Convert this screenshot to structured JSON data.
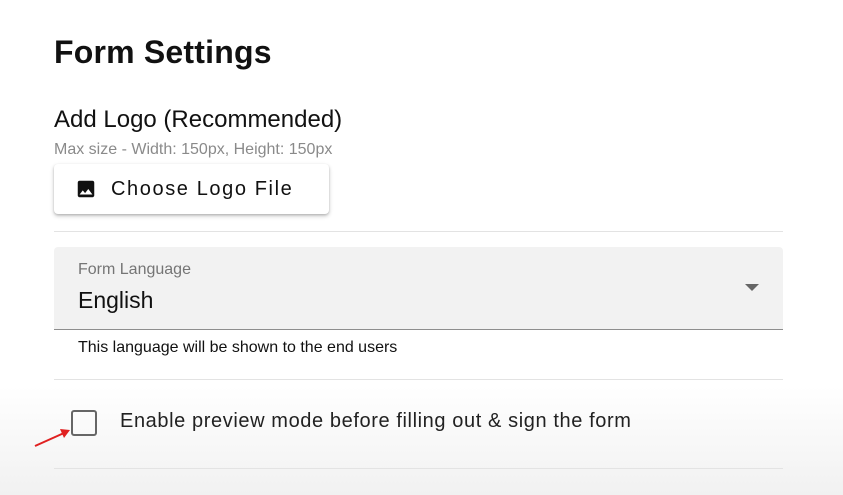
{
  "page": {
    "title": "Form Settings"
  },
  "logo": {
    "heading": "Add Logo (Recommended)",
    "hint": "Max size - Width: 150px, Height: 150px",
    "button_label": "Choose Logo File",
    "button_icon": "image-icon"
  },
  "language": {
    "label": "Form Language",
    "value": "English",
    "helper": "This language will be shown to the end users",
    "dropdown_icon": "caret-down-icon"
  },
  "preview_mode": {
    "label": "Enable preview mode before filling out & sign the form",
    "checked": false
  },
  "annotation": {
    "arrow_color": "#e02020"
  },
  "colors": {
    "field_background": "#f2f2f2",
    "divider": "#e3e3e3",
    "hint_text": "#8a8a8a"
  }
}
